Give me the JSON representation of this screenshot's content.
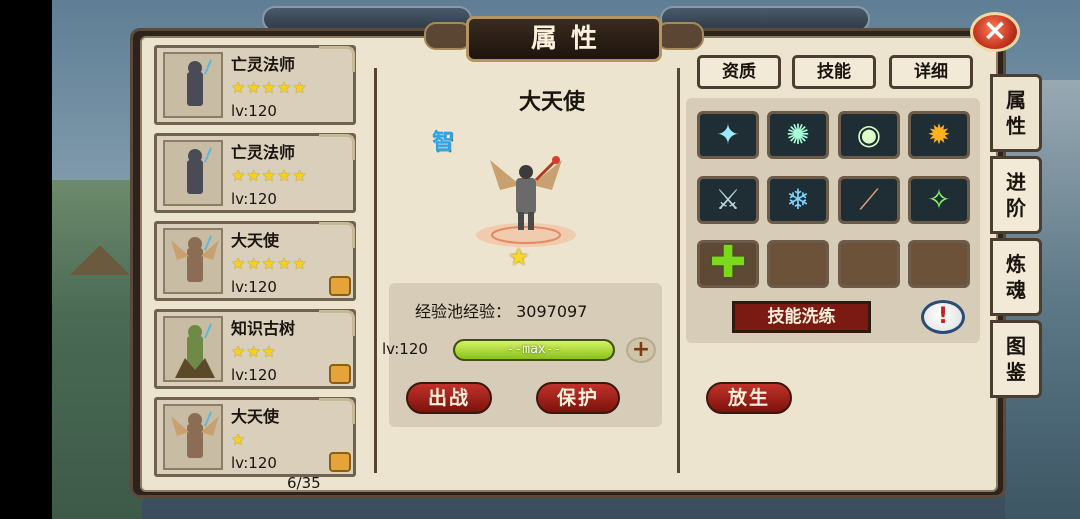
{
  "title": "属性",
  "close_label": "×",
  "hero_list": [
    {
      "name": "亡灵法师",
      "stars": "★★★★★",
      "level": "lv:120",
      "locked": false
    },
    {
      "name": "亡灵法师",
      "stars": "★★★★★",
      "level": "lv:120",
      "locked": false
    },
    {
      "name": "大天使",
      "stars": "★★★★★",
      "level": "lv:120",
      "locked": true
    },
    {
      "name": "知识古树",
      "stars": "★★★",
      "level": "lv:120",
      "locked": true
    },
    {
      "name": "大天使",
      "stars": "★",
      "level": "lv:120",
      "locked": true
    }
  ],
  "page_counter": "6/35",
  "selected_hero": {
    "name": "大天使",
    "attribute_badge": "智",
    "star": "★",
    "exp_pool_label": "经验池经验：",
    "exp_pool_value": "3097097",
    "level": "lv:120",
    "level_bar_text": "--max--",
    "level_fill_fraction": 1.0
  },
  "actions": {
    "deploy": "出战",
    "protect": "保护",
    "release": "放生",
    "add_exp": "+"
  },
  "tabs": [
    "资质",
    "技能",
    "详细"
  ],
  "skills": [
    {
      "icon": "wing-skill-icon",
      "glyph": "✦",
      "color": "#9be9ff"
    },
    {
      "icon": "light-burst-skill-icon",
      "glyph": "✺",
      "color": "#a6ffd9"
    },
    {
      "icon": "wind-disc-skill-icon",
      "glyph": "◉",
      "color": "#dfffc8"
    },
    {
      "icon": "fire-skill-icon",
      "glyph": "✹",
      "color": "#ffb020"
    },
    {
      "icon": "sword-skill-icon",
      "glyph": "⚔",
      "color": "#b8d8e0"
    },
    {
      "icon": "ice-strike-skill-icon",
      "glyph": "❄",
      "color": "#7fd3ff"
    },
    {
      "icon": "claw-skill-icon",
      "glyph": "⟋",
      "color": "#e0a070"
    },
    {
      "icon": "sparkle-skill-icon",
      "glyph": "✧",
      "color": "#8cff6a"
    }
  ],
  "refine_label": "技能洗练",
  "info_label": "!",
  "side_tabs": [
    "属性",
    "进阶",
    "炼魂",
    "图鉴"
  ]
}
